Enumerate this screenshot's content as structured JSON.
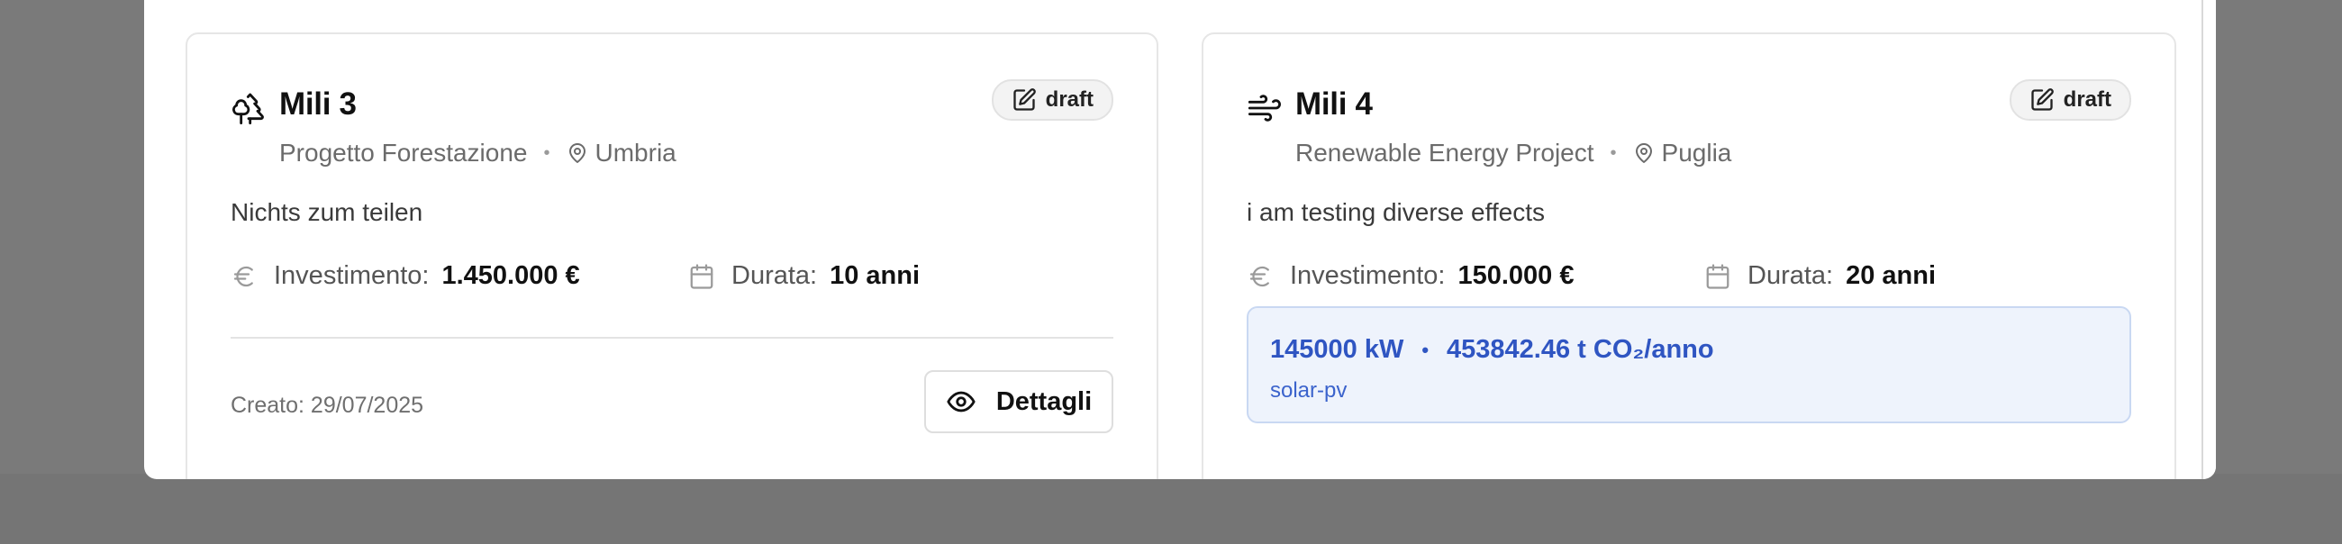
{
  "cards": [
    {
      "icon": "trees-icon",
      "title": "Mili 3",
      "category": "Progetto Forestazione",
      "location": "Umbria",
      "status": "draft",
      "description": "Nichts zum teilen",
      "investment_label": "Investimento:",
      "investment_value": "1.450.000 €",
      "duration_label": "Durata:",
      "duration_value": "10 anni",
      "created": "Creato: 29/07/2025",
      "details_label": "Dettagli"
    },
    {
      "icon": "wind-icon",
      "title": "Mili 4",
      "category": "Renewable Energy Project",
      "location": "Puglia",
      "status": "draft",
      "description": "i am testing diverse effects",
      "investment_label": "Investimento:",
      "investment_value": "150.000 €",
      "duration_label": "Durata:",
      "duration_value": "20 anni",
      "energy": {
        "power": "145000 kW",
        "co2": "453842.46 t CO₂/anno",
        "technology": "solar-pv"
      }
    }
  ],
  "colors": {
    "overlay": "#7a7a7a",
    "energy_text": "#2f55c2",
    "energy_bg": "#eef3fc"
  }
}
